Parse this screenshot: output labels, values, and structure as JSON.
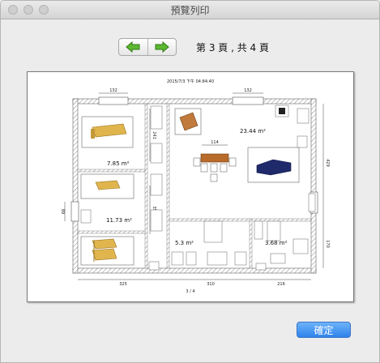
{
  "window": {
    "title": "預覽列印"
  },
  "nav": {
    "page_indicator": "第 3 頁 , 共 4 頁"
  },
  "paper": {
    "timestamp": "2015/7/3 下午 04:84:40",
    "page_footer": "3 / 4",
    "rooms": {
      "room1_area": "7.85 m²",
      "room2_area": "11.73 m²",
      "living_area": "23.44 m²",
      "small_area": "5.3 m²",
      "bath_area": "3.68 m²"
    },
    "dimensions": {
      "top_left": "132",
      "top_right": "132",
      "table": "114",
      "corridor": "241",
      "corridor2": "358",
      "right_top": "429",
      "right_bottom": "170",
      "left_side": "89",
      "bottom_left": "325",
      "bottom_mid": "310",
      "bottom_right": "216"
    }
  },
  "buttons": {
    "ok": "確定"
  },
  "colors": {
    "accent": "#2f82ec",
    "wall": "#8a8a8a",
    "bed": "#e0b54d",
    "sofa": "#1f2a6b"
  }
}
